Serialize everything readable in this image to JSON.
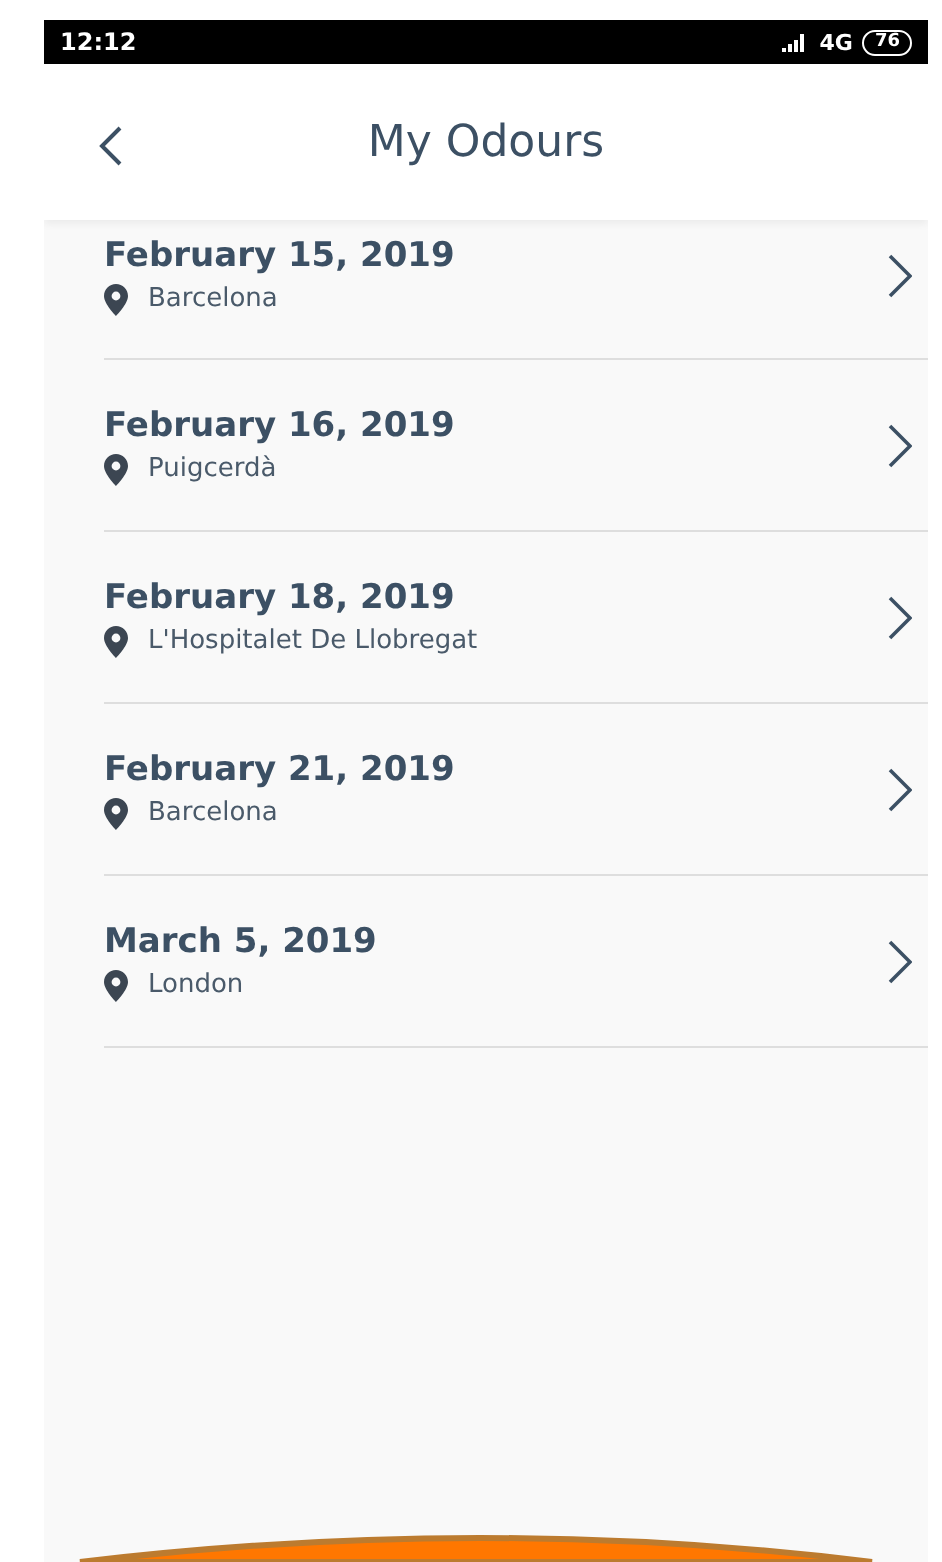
{
  "status_bar": {
    "time": "12:12",
    "network": "4G",
    "battery": "76"
  },
  "header": {
    "title": "My Odours"
  },
  "odours": [
    {
      "date": "February 15, 2019",
      "location": "Barcelona"
    },
    {
      "date": "February 16, 2019",
      "location": "Puigcerdà"
    },
    {
      "date": "February 18, 2019",
      "location": "L'Hospitalet De Llobregat"
    },
    {
      "date": "February 21, 2019",
      "location": "Barcelona"
    },
    {
      "date": "March 5, 2019",
      "location": "London"
    }
  ]
}
